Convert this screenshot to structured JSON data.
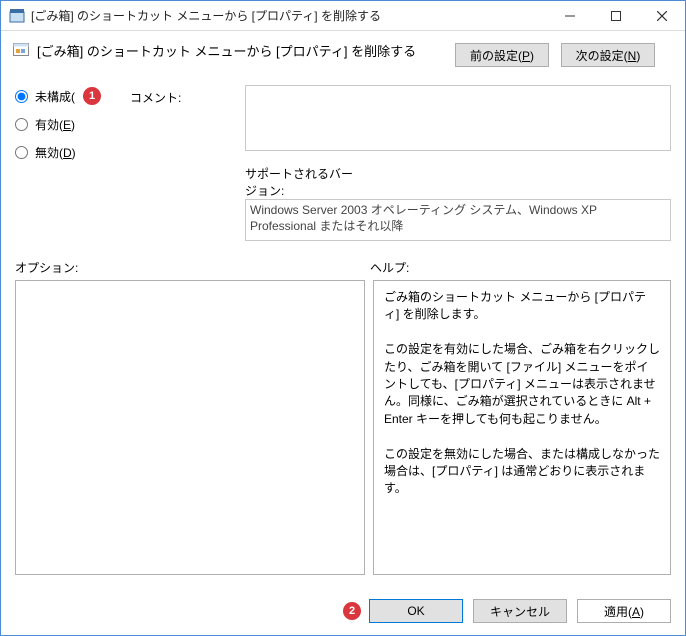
{
  "window": {
    "title": "[ごみ箱] のショートカット メニューから [プロパティ] を削除する"
  },
  "subheader": {
    "title": "[ごみ箱] のショートカット メニューから [プロパティ] を削除する"
  },
  "nav": {
    "prev_label": "前の設定(",
    "prev_key": "P",
    "next_label": "次の設定(",
    "next_key": "N",
    "close_paren": ")"
  },
  "radios": {
    "not_configured": {
      "label": "未構成("
    },
    "enabled": {
      "label": "有効(",
      "key": "E",
      "close": ")"
    },
    "disabled": {
      "label": "無効(",
      "key": "D",
      "close": ")"
    },
    "selected": "not_configured"
  },
  "badges": {
    "one": "1",
    "two": "2"
  },
  "comment": {
    "label": "コメント:",
    "value": ""
  },
  "support": {
    "label": "サポートされるバージョン:",
    "value": "Windows Server 2003 オペレーティング システム、Windows XP Professional またはそれ以降"
  },
  "labels": {
    "options": "オプション:",
    "help": "ヘルプ:"
  },
  "help": {
    "p1": "ごみ箱のショートカット メニューから [プロパティ] を削除します。",
    "p2": "この設定を有効にした場合、ごみ箱を右クリックしたり、ごみ箱を開いて [ファイル] メニューをポイントしても、[プロパティ] メニューは表示されません。同様に、ごみ箱が選択されているときに Alt + Enter キーを押しても何も起こりません。",
    "p3": "この設定を無効にした場合、または構成しなかった場合は、[プロパティ] は通常どおりに表示されます。"
  },
  "footer": {
    "ok": "OK",
    "cancel": "キャンセル",
    "apply_label": "適用(",
    "apply_key": "A",
    "close_paren": ")"
  }
}
